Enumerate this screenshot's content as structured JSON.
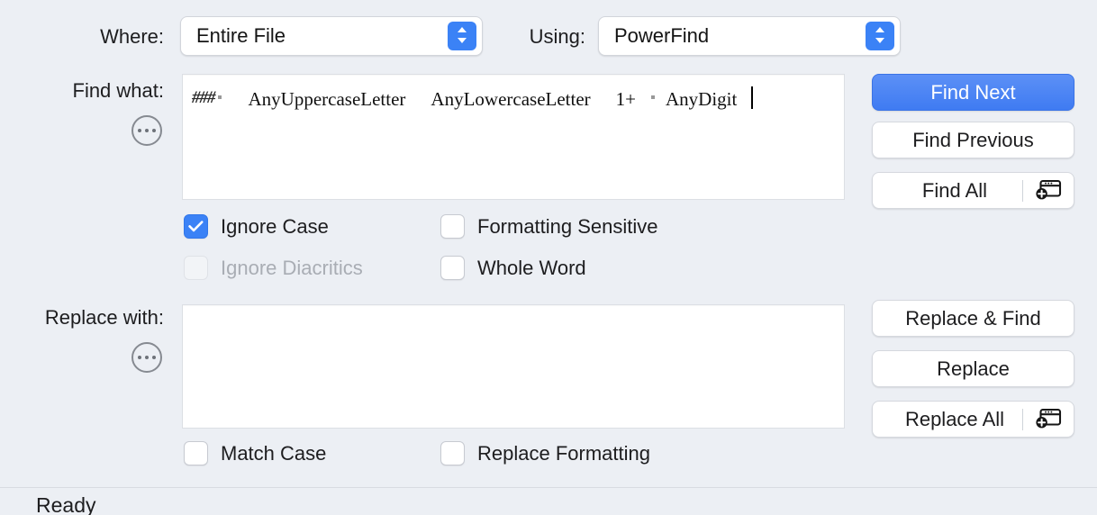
{
  "dialog": {
    "background_color": "#eceff4",
    "accent_color": "#3b82f6",
    "primary_button_color": "#4581f2"
  },
  "where": {
    "label": "Where:",
    "value": "Entire File",
    "icon": "chevron-up-down-icon"
  },
  "using": {
    "label": "Using:",
    "value": "PowerFind",
    "icon": "chevron-up-down-icon"
  },
  "find": {
    "label": "Find what:",
    "options_icon": "ellipsis-circle-icon",
    "tokens": {
      "hash": "###",
      "uppercase": "AnyUppercaseLetter",
      "lowercase": "AnyLowercaseLetter",
      "repeat": "1+",
      "digit": "AnyDigit"
    }
  },
  "replace": {
    "label": "Replace with:",
    "options_icon": "ellipsis-circle-icon",
    "value": ""
  },
  "checkboxes": [
    {
      "name": "ignore-case",
      "label": "Ignore Case",
      "checked": true,
      "disabled": false
    },
    {
      "name": "formatting-sensitive",
      "label": "Formatting Sensitive",
      "checked": false,
      "disabled": false
    },
    {
      "name": "ignore-diacritics",
      "label": "Ignore Diacritics",
      "checked": false,
      "disabled": true
    },
    {
      "name": "whole-word",
      "label": "Whole Word",
      "checked": false,
      "disabled": false
    },
    {
      "name": "match-case",
      "label": "Match Case",
      "checked": false,
      "disabled": false
    },
    {
      "name": "replace-formatting",
      "label": "Replace Formatting",
      "checked": false,
      "disabled": false
    }
  ],
  "buttons": {
    "find_next": "Find Next",
    "find_previous": "Find Previous",
    "find_all": "Find All",
    "replace_and_find": "Replace & Find",
    "replace": "Replace",
    "replace_all": "Replace All",
    "split_icon": "new-window-plus-icon"
  },
  "status": {
    "text": "Ready"
  }
}
